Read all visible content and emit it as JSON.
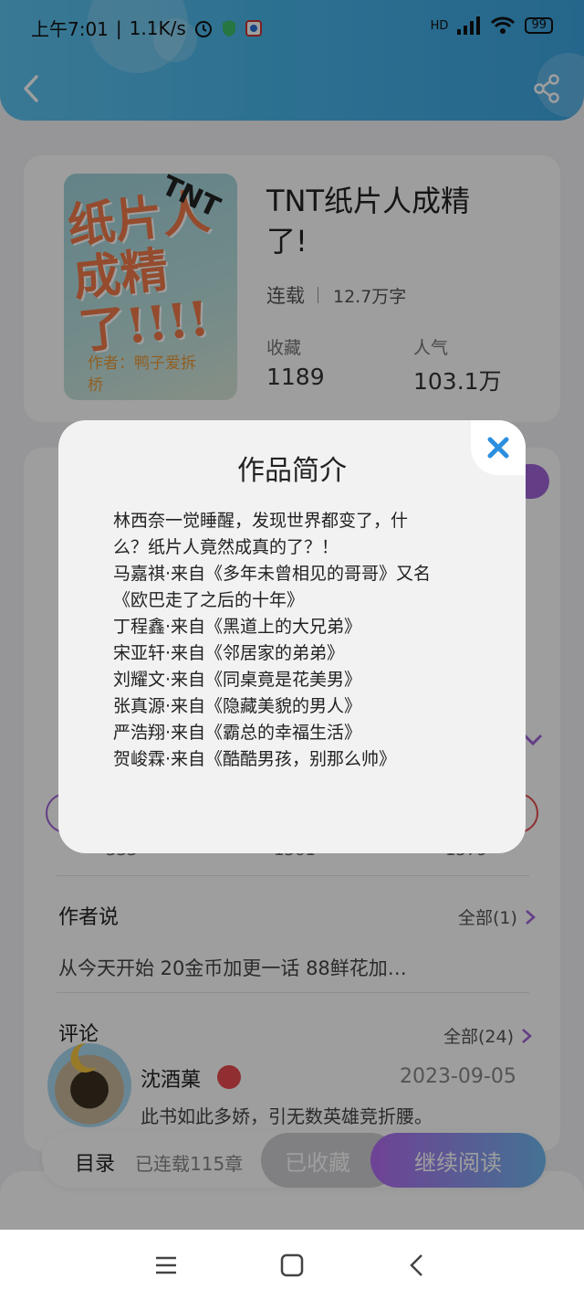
{
  "status_bar": {
    "time": "上午7:01",
    "speed": "1.1K/s",
    "signal_label": "HD",
    "battery": "99"
  },
  "header": {
    "back_icon": "chevron-left-icon",
    "share_icon": "share-icon"
  },
  "book": {
    "cover_text_main": "纸片人成精了!!!!",
    "cover_text_tnt": "TNT",
    "cover_author_line1": "作者：鸭子爱拆",
    "cover_author_line2": "桥",
    "title": "TNT纸片人成精了!",
    "status": "连载",
    "word_count": "12.7万字",
    "favorites_label": "收藏",
    "favorites_value": "1189",
    "popularity_label": "人气",
    "popularity_value": "103.1万"
  },
  "background_content": {
    "partial_numbers": [
      "333",
      "1561",
      "1579"
    ],
    "author_says_title": "作者说",
    "author_says_more": "全部(1)",
    "author_says_text": "从今天开始 20金币加更一话  88鲜花加…",
    "comments_title": "评论",
    "comments_more": "全部(24)",
    "comment": {
      "user": "沈酒菓",
      "date": "2023-09-05",
      "text": "此书如此多娇，引无数英雄竞折腰。"
    }
  },
  "bottom_bar": {
    "toc_label": "目录",
    "toc_sub": "已连载115章",
    "favorited_label": "已收藏",
    "continue_label": "继续阅读"
  },
  "modal": {
    "title": "作品简介",
    "close_icon": "close-icon",
    "lines": [
      "林西奈一觉睡醒，发现世界都变了，什",
      "么？纸片人竟然成真的了？！",
      "马嘉祺·来自《多年未曾相见的哥哥》又名",
      "《欧巴走了之后的十年》",
      "丁程鑫·来自《黑道上的大兄弟》",
      "宋亚轩·来自《邻居家的弟弟》",
      "刘耀文·来自《同桌竟是花美男》",
      "张真源·来自《隐藏美貌的男人》",
      "严浩翔·来自《霸总的幸福生活》",
      "贺峻霖·来自《酷酷男孩，别那么帅》"
    ]
  },
  "colors": {
    "header_blue": "#49b6ea",
    "accent_purple": "#a064d8",
    "close_blue": "#2b8fe0"
  }
}
